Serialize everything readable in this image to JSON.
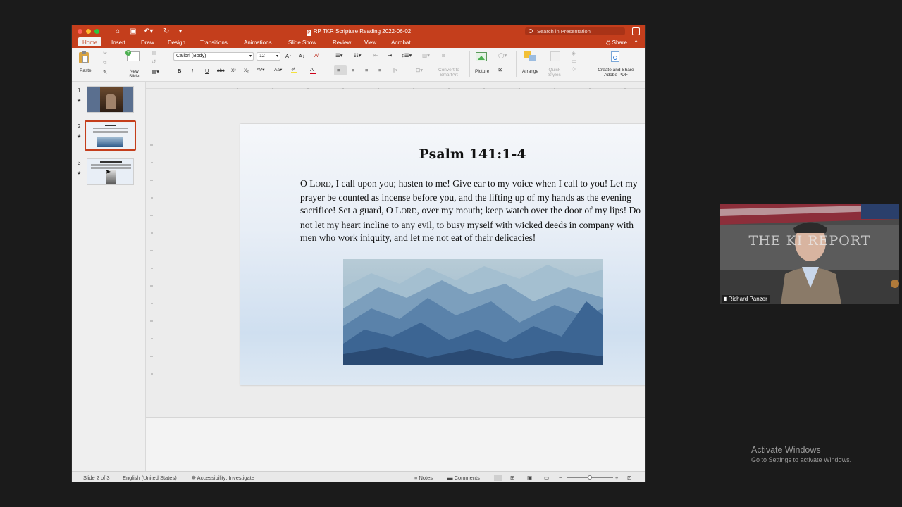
{
  "window": {
    "title": "RP TKR Scripture Reading 2022-06-02",
    "search_placeholder": "Search in Presentation",
    "share_label": "Share"
  },
  "tabs": [
    {
      "label": "Home",
      "active": true
    },
    {
      "label": "Insert"
    },
    {
      "label": "Draw"
    },
    {
      "label": "Design"
    },
    {
      "label": "Transitions"
    },
    {
      "label": "Animations"
    },
    {
      "label": "Slide Show"
    },
    {
      "label": "Review"
    },
    {
      "label": "View"
    },
    {
      "label": "Acrobat"
    }
  ],
  "ribbon": {
    "paste_label": "Paste",
    "new_slide_label_1": "New",
    "new_slide_label_2": "Slide",
    "font_name": "Calibri (Body)",
    "font_size": "12",
    "bold": "B",
    "italic": "I",
    "underline": "U",
    "strike": "abc",
    "superscript": "X²",
    "subscript": "X₂",
    "convert_smartart_1": "Convert to",
    "convert_smartart_2": "SmartArt",
    "picture_label": "Picture",
    "arrange_label": "Arrange",
    "quick_styles_1": "Quick",
    "quick_styles_2": "Styles",
    "adobe_pdf_1": "Create and Share",
    "adobe_pdf_2": "Adobe PDF"
  },
  "thumbnails": [
    {
      "number": "1"
    },
    {
      "number": "2",
      "selected": true
    },
    {
      "number": "3"
    }
  ],
  "slide": {
    "title": "Psalm 141:1-4",
    "body_parts": {
      "p1": "O ",
      "lord1_L": "L",
      "lord1_rest": "ORD",
      "p2": ", I call upon you; hasten to me! Give ear to my voice when I call to you! Let my prayer be counted as incense before you, and the lifting up of my hands as the evening sacrifice! Set a guard, O ",
      "lord2_L": "L",
      "lord2_rest": "ORD",
      "p3": ", over my mouth; keep watch over the door of my lips! Do not let my heart incline to any evil, to busy myself with wicked deeds in company with men who work iniquity, and let me not eat of their delicacies!"
    }
  },
  "statusbar": {
    "slide_indicator": "Slide 2 of 3",
    "language": "English (United States)",
    "accessibility": "Accessibility: Investigate",
    "notes": "Notes",
    "comments": "Comments"
  },
  "webcam": {
    "overlay_text": "THE KI      REPORT",
    "participant_name": "Richard Panzer"
  },
  "watermark": {
    "title": "Activate Windows",
    "subtitle": "Go to Settings to activate Windows."
  },
  "colors": {
    "accent": "#c43e1c",
    "titlebar": "#c43e1c"
  }
}
